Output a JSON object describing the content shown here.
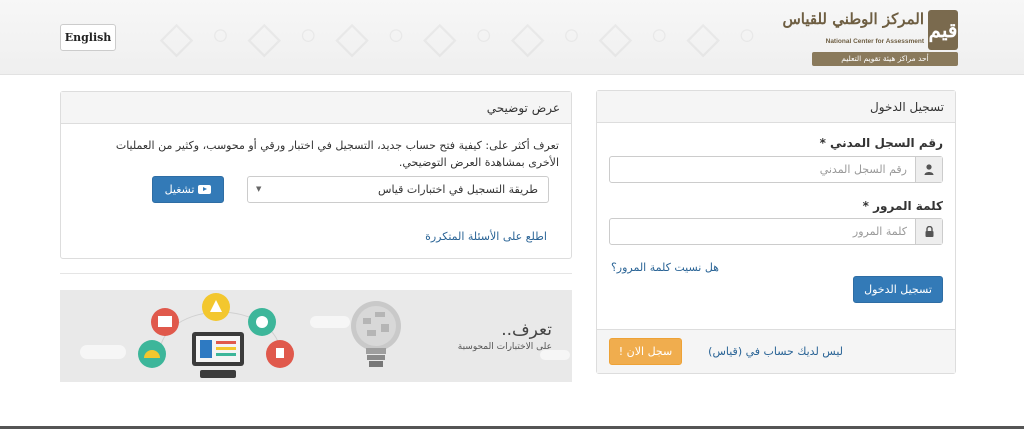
{
  "header": {
    "language_button": "English",
    "logo": {
      "mark": "قيم",
      "arabic_name": "المركز الوطني للقياس",
      "english_name": "National Center for Assessment",
      "tagline": "أحد مراكز هيئة تقويم التعليم"
    }
  },
  "login": {
    "title": "تسجيل الدخول",
    "id_label": "رقم السجل المدني",
    "id_placeholder": "رقم السجل المدني",
    "password_label": "كلمة المرور",
    "password_placeholder": "كلمة المرور",
    "required_mark": "*",
    "forgot_link": "هل نسيت كلمة المرور؟",
    "submit_button": "تسجيل الدخول",
    "no_account_text": "ليس لديك حساب في (قياس)",
    "register_button": "سجل الان !",
    "icons": [
      "user-icon",
      "lock-icon"
    ]
  },
  "demo": {
    "title": "عرض توضيحي",
    "description": "تعرف أكثر على: كيفية فتح حساب جديد، التسجيل في اختبار ورقي أو محوسب، وكثير من العمليات الأخرى بمشاهدة العرض التوضيحي.",
    "select_value": "طريقة التسجيل في اختبارات قياس",
    "play_button": "تشغيل",
    "faq_link": "اطلع على الأسئلة المتكررة"
  },
  "banner": {
    "title": "تعرف..",
    "subtitle": "على الاختبارات المحوسبة"
  },
  "colors": {
    "primary": "#337ab7",
    "warning": "#f0ad4e",
    "link": "#2a6496",
    "logo_brown": "#7a6a4e"
  }
}
